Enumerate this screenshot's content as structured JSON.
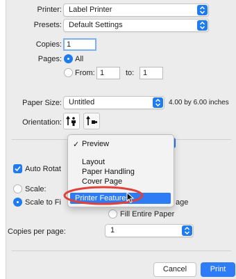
{
  "form": {
    "printer_label": "Printer:",
    "printer_value": "Label Printer",
    "presets_label": "Presets:",
    "presets_value": "Default Settings",
    "copies_label": "Copies:",
    "copies_value": "1",
    "pages_label": "Pages:",
    "pages_all": "All",
    "pages_from_label": "From:",
    "pages_from_value": "1",
    "pages_to_label": "to:",
    "pages_to_value": "1",
    "paper_size_label": "Paper Size:",
    "paper_size_value": "Untitled",
    "paper_size_dims": "4.00 by 6.00 inches",
    "orientation_label": "Orientation:"
  },
  "options": {
    "auto_rotate": "Auto Rotat",
    "scale": "Scale:",
    "scale_to_fit": "Scale to Fi",
    "scale_to_fit_tail": "age",
    "fill_entire_paper": "Fill Entire Paper",
    "copies_per_page_label": "Copies per page:",
    "copies_per_page_value": "1"
  },
  "menu": {
    "check_mark": "✓",
    "items": [
      "Preview",
      "Layout",
      "Paper Handling",
      "Cover Page",
      "Printer Features"
    ]
  },
  "buttons": {
    "cancel": "Cancel",
    "print": "Print"
  },
  "colors": {
    "accent": "#1f7bf2",
    "highlight_circle": "#e0413b",
    "background": "#ececec"
  },
  "icons": [
    "up-down-stepper-icon",
    "portrait-orientation-icon",
    "landscape-orientation-icon",
    "checkmark-icon",
    "mouse-pointer-icon"
  ]
}
